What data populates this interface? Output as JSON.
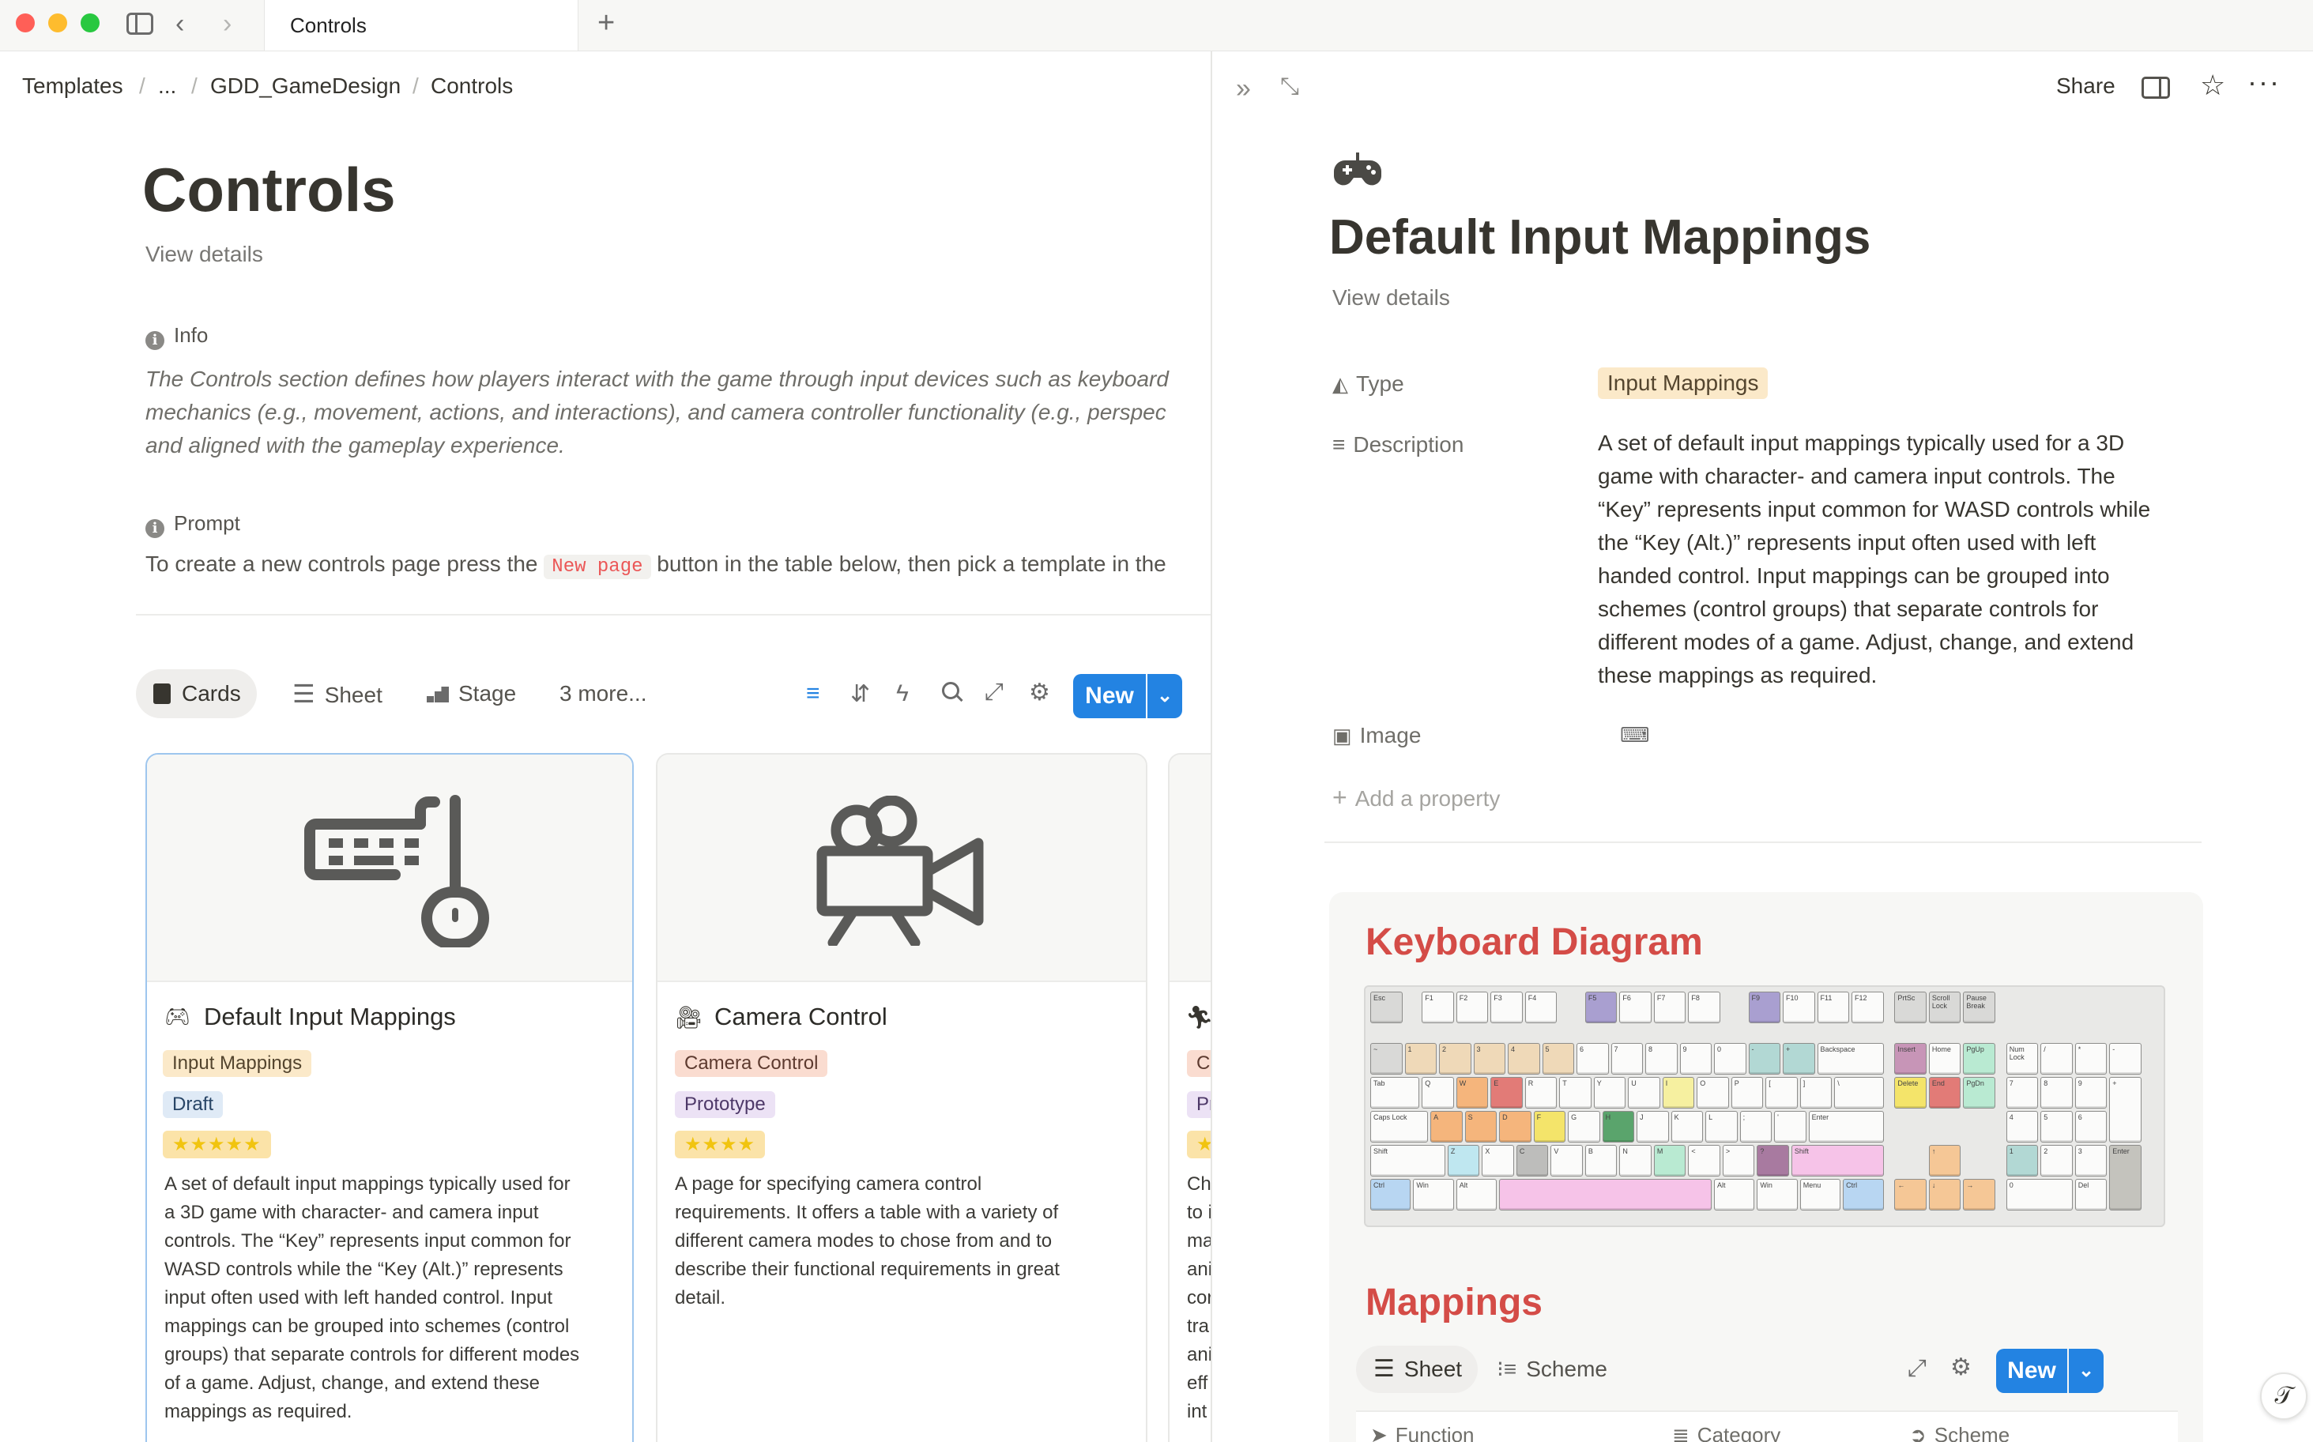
{
  "window": {
    "tab_title": "Controls",
    "new_tab_icon": "plus-icon"
  },
  "breadcrumb": [
    "Templates",
    "...",
    "GDD_GameDesign",
    "Controls"
  ],
  "page": {
    "title": "Controls",
    "view_details": "View details",
    "info_label": "Info",
    "info_text": [
      "The Controls section defines how players interact with the game through input devices such as keyboard",
      "mechanics (e.g., movement, actions, and interactions), and camera controller functionality (e.g., perspec",
      "and aligned with the gameplay experience."
    ],
    "prompt_label": "Prompt",
    "prompt_before": "To create a new controls page press the",
    "prompt_code": "New page",
    "prompt_after": "button in the table below, then pick a template in the"
  },
  "views": {
    "tabs": [
      "Cards",
      "Sheet",
      "Stage",
      "3 more..."
    ],
    "active": "Cards",
    "new_label": "New"
  },
  "cards": [
    {
      "title": "Default Input Mappings",
      "icon": "gamepad-icon",
      "cover_icon": "keyboard-mouse-icon",
      "tags": [
        "Input Mappings",
        "Draft"
      ],
      "rating": "★★★★★",
      "body": [
        "A set of default input mappings typically used for",
        "a 3D game with character- and camera input",
        "controls. The “Key” represents input common for",
        "WASD controls while the “Key (Alt.)” represents",
        "input often used with left handed control. Input",
        "mappings can be grouped into schemes (control",
        "groups) that separate controls for different modes",
        "of a game. Adjust, change, and extend these",
        "mappings as required."
      ]
    },
    {
      "title": "Camera Control",
      "icon": "video-camera-icon",
      "cover_icon": "movie-camera-icon",
      "tags": [
        "Camera Control",
        "Prototype"
      ],
      "rating": "★★★★",
      "body": [
        "A page for specifying camera control",
        "requirements. It offers a table with a variety of",
        "different camera modes to chose from and to",
        "describe their functional requirements in great",
        "detail."
      ]
    },
    {
      "title": "",
      "icon": "running-figure-icon",
      "tags": [
        "Ch",
        "Pr"
      ],
      "rating": "★",
      "body": [
        "Ch",
        "to i",
        "ma",
        "ani",
        "cor",
        "tra",
        "ani",
        "eff",
        "int"
      ]
    }
  ],
  "panel": {
    "share_label": "Share",
    "icon": "gamepad-icon",
    "title": "Default Input Mappings",
    "view_details": "View details",
    "properties": {
      "type_label": "Type",
      "type_value": "Input Mappings",
      "description_label": "Description",
      "description_lines": [
        "A set of default input mappings typically used for a 3D",
        "game with character- and camera input controls. The",
        "“Key” represents input common for WASD controls while",
        "the “Key (Alt.)” represents input often used with left",
        "handed control. Input mappings can be grouped into",
        "schemes (control groups) that separate controls for",
        "different modes of a game. Adjust, change, and extend",
        "these mappings as required."
      ],
      "image_label": "Image",
      "add_property": "Add a property"
    },
    "keyboard_heading": "Keyboard Diagram",
    "mappings_heading": "Mappings",
    "mappings_tabs": [
      "Sheet",
      "Scheme"
    ],
    "mappings_new": "New",
    "columns": [
      "Function",
      "Category",
      "Scheme"
    ]
  },
  "keyboard": {
    "rows": [
      [
        [
          "Esc",
          0,
          1,
          "#d9d9d7"
        ],
        [
          "F1",
          1.5,
          1,
          ""
        ],
        [
          "F2",
          2.5,
          1,
          ""
        ],
        [
          "F3",
          3.5,
          1,
          ""
        ],
        [
          "F4",
          4.5,
          1,
          ""
        ],
        [
          "F5",
          6.25,
          1,
          "#a99fd0"
        ],
        [
          "F6",
          7.25,
          1,
          ""
        ],
        [
          "F7",
          8.25,
          1,
          ""
        ],
        [
          "F8",
          9.25,
          1,
          ""
        ],
        [
          "F9",
          11,
          1,
          "#a99fd0"
        ],
        [
          "F10",
          12,
          1,
          ""
        ],
        [
          "F11",
          13,
          1,
          ""
        ],
        [
          "F12",
          14,
          1,
          ""
        ],
        [
          "PrtSc",
          15.25,
          1,
          "#d9d9d7"
        ],
        [
          "Scroll Lock",
          16.25,
          1,
          "#d9d9d7"
        ],
        [
          "Pause Break",
          17.25,
          1,
          "#d9d9d7"
        ]
      ],
      [
        [
          "~",
          0,
          1,
          "#d9d9d7"
        ],
        [
          "1",
          1,
          1,
          "#efd9b8"
        ],
        [
          "2",
          2,
          1,
          "#efd9b8"
        ],
        [
          "3",
          3,
          1,
          "#efd9b8"
        ],
        [
          "4",
          4,
          1,
          "#efd9b8"
        ],
        [
          "5",
          5,
          1,
          "#efd9b8"
        ],
        [
          "6",
          6,
          1,
          ""
        ],
        [
          "7",
          7,
          1,
          ""
        ],
        [
          "8",
          8,
          1,
          ""
        ],
        [
          "9",
          9,
          1,
          ""
        ],
        [
          "0",
          10,
          1,
          ""
        ],
        [
          "-",
          11,
          1,
          "#b2d8d4"
        ],
        [
          "+",
          12,
          1,
          "#b2d8d4"
        ],
        [
          "Backspace",
          13,
          2,
          ""
        ],
        [
          "Insert",
          15.25,
          1,
          "#c795b7"
        ],
        [
          "Home",
          16.25,
          1,
          ""
        ],
        [
          "PgUp",
          17.25,
          1,
          "#b9ead2"
        ],
        [
          "Num Lock",
          18.5,
          1,
          ""
        ],
        [
          "/",
          19.5,
          1,
          ""
        ],
        [
          "*",
          20.5,
          1,
          ""
        ],
        [
          "-",
          21.5,
          1,
          ""
        ]
      ],
      [
        [
          "Tab",
          0,
          1.5,
          ""
        ],
        [
          "Q",
          1.5,
          1,
          ""
        ],
        [
          "W",
          2.5,
          1,
          "#f5b57c"
        ],
        [
          "E",
          3.5,
          1,
          "#e27b77"
        ],
        [
          "R",
          4.5,
          1,
          ""
        ],
        [
          "T",
          5.5,
          1,
          ""
        ],
        [
          "Y",
          6.5,
          1,
          ""
        ],
        [
          "U",
          7.5,
          1,
          ""
        ],
        [
          "I",
          8.5,
          1,
          "#f6f0a0"
        ],
        [
          "O",
          9.5,
          1,
          ""
        ],
        [
          "P",
          10.5,
          1,
          ""
        ],
        [
          "[",
          11.5,
          1,
          ""
        ],
        [
          "]",
          12.5,
          1,
          ""
        ],
        [
          "\\",
          13.5,
          1.5,
          ""
        ],
        [
          "Delete",
          15.25,
          1,
          "#f4e46a"
        ],
        [
          "End",
          16.25,
          1,
          "#e27b77"
        ],
        [
          "PgDn",
          17.25,
          1,
          "#b9ead2"
        ],
        [
          "7",
          18.5,
          1,
          ""
        ],
        [
          "8",
          19.5,
          1,
          ""
        ],
        [
          "9",
          20.5,
          1,
          ""
        ]
      ],
      [
        [
          "Caps Lock",
          0,
          1.75,
          ""
        ],
        [
          "A",
          1.75,
          1,
          "#f5b57c"
        ],
        [
          "S",
          2.75,
          1,
          "#f5b57c"
        ],
        [
          "D",
          3.75,
          1,
          "#f5b57c"
        ],
        [
          "F",
          4.75,
          1,
          "#f4e46a"
        ],
        [
          "G",
          5.75,
          1,
          ""
        ],
        [
          "H",
          6.75,
          1,
          "#5aa46c"
        ],
        [
          "J",
          7.75,
          1,
          ""
        ],
        [
          "K",
          8.75,
          1,
          ""
        ],
        [
          "L",
          9.75,
          1,
          ""
        ],
        [
          ";",
          10.75,
          1,
          ""
        ],
        [
          "'",
          11.75,
          1,
          ""
        ],
        [
          "Enter",
          12.75,
          2.25,
          ""
        ],
        [
          "4",
          18.5,
          1,
          ""
        ],
        [
          "5",
          19.5,
          1,
          ""
        ],
        [
          "6",
          20.5,
          1,
          ""
        ]
      ],
      [
        [
          "Shift",
          0,
          2.25,
          ""
        ],
        [
          "Z",
          2.25,
          1,
          "#bfe7f0"
        ],
        [
          "X",
          3.25,
          1,
          ""
        ],
        [
          "C",
          4.25,
          1,
          "#bdbdbb"
        ],
        [
          "V",
          5.25,
          1,
          ""
        ],
        [
          "B",
          6.25,
          1,
          ""
        ],
        [
          "N",
          7.25,
          1,
          ""
        ],
        [
          "M",
          8.25,
          1,
          "#b9ead2"
        ],
        [
          "<",
          9.25,
          1,
          ""
        ],
        [
          ">",
          10.25,
          1,
          ""
        ],
        [
          "?",
          11.25,
          1,
          "#a87aa0"
        ],
        [
          "Shift",
          12.25,
          2.75,
          "#f6c3e8"
        ],
        [
          "↑",
          16.25,
          1,
          "#f5c796"
        ],
        [
          "1",
          18.5,
          1,
          "#b2d8d4"
        ],
        [
          "2",
          19.5,
          1,
          ""
        ],
        [
          "3",
          20.5,
          1,
          ""
        ]
      ],
      [
        [
          "Ctrl",
          0,
          1.25,
          "#b8d6f2"
        ],
        [
          "Win",
          1.25,
          1.25,
          ""
        ],
        [
          "Alt",
          2.5,
          1.25,
          ""
        ],
        [
          "",
          3.75,
          6.25,
          "#f6c3e8"
        ],
        [
          "Alt",
          10,
          1.25,
          ""
        ],
        [
          "Win",
          11.25,
          1.25,
          ""
        ],
        [
          "Menu",
          12.5,
          1.25,
          ""
        ],
        [
          "Ctrl",
          13.75,
          1.25,
          "#b8d6f2"
        ],
        [
          "←",
          15.25,
          1,
          "#f5c796"
        ],
        [
          "↓",
          16.25,
          1,
          "#f5c796"
        ],
        [
          "→",
          17.25,
          1,
          "#f5c796"
        ],
        [
          "0",
          18.5,
          2,
          ""
        ],
        [
          "Del",
          20.5,
          1,
          ""
        ]
      ]
    ],
    "tall_keys": [
      [
        "+",
        21.5,
        2,
        2,
        ""
      ],
      [
        "Enter",
        21.5,
        4,
        2,
        "#c4c3bd"
      ]
    ]
  }
}
